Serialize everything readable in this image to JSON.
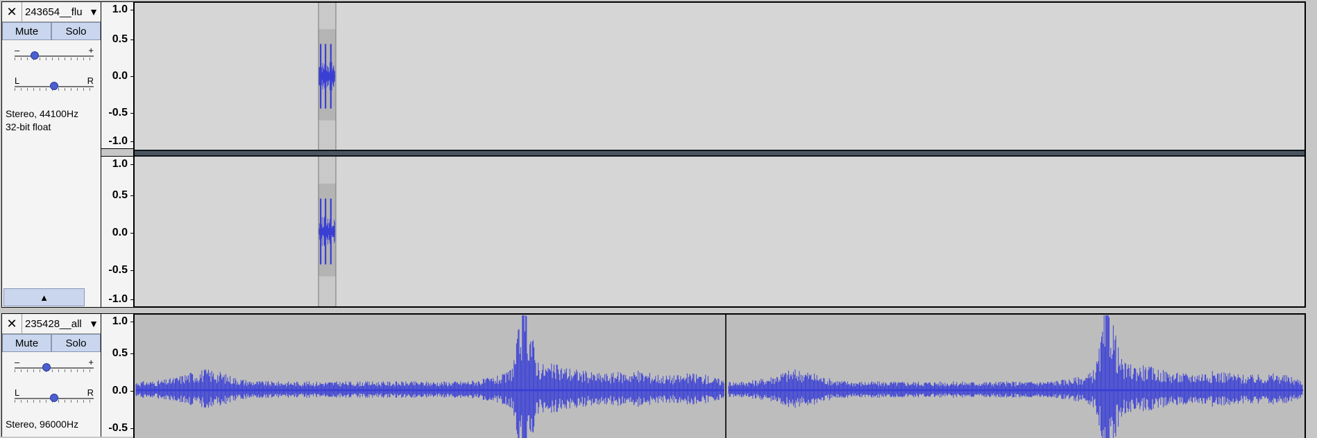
{
  "tracks": [
    {
      "name": "243654__flu",
      "close_glyph": "✕",
      "menu_glyph": "▼",
      "mute_label": "Mute",
      "solo_label": "Solo",
      "gain": {
        "minus": "–",
        "plus": "+",
        "value": 0.25
      },
      "pan": {
        "left": "L",
        "right": "R",
        "value": 0.5
      },
      "info": "Stereo, 44100Hz\n32-bit float",
      "collapse_glyph": "▲",
      "channels": [
        {
          "ticks": [
            "1.0",
            "0.5",
            "0.0",
            "-0.5",
            "-1.0"
          ]
        },
        {
          "ticks": [
            "1.0",
            "0.5",
            "0.0",
            "-0.5",
            "-1.0"
          ]
        }
      ]
    },
    {
      "name": "235428__all",
      "close_glyph": "✕",
      "menu_glyph": "▼",
      "mute_label": "Mute",
      "solo_label": "Solo",
      "gain": {
        "minus": "–",
        "plus": "+",
        "value": 0.4
      },
      "pan": {
        "left": "L",
        "right": "R",
        "value": 0.5
      },
      "info": "Stereo, 96000Hz",
      "channels": [
        {
          "ticks": [
            "1.0",
            "0.5",
            "0.0",
            "-0.5"
          ]
        }
      ]
    }
  ],
  "colors": {
    "waveform": "#3a3fd4",
    "track_bg": "#d6d6d6",
    "clip_bg": "#bdbdbd",
    "selection_bg": "#c4c4c4"
  }
}
